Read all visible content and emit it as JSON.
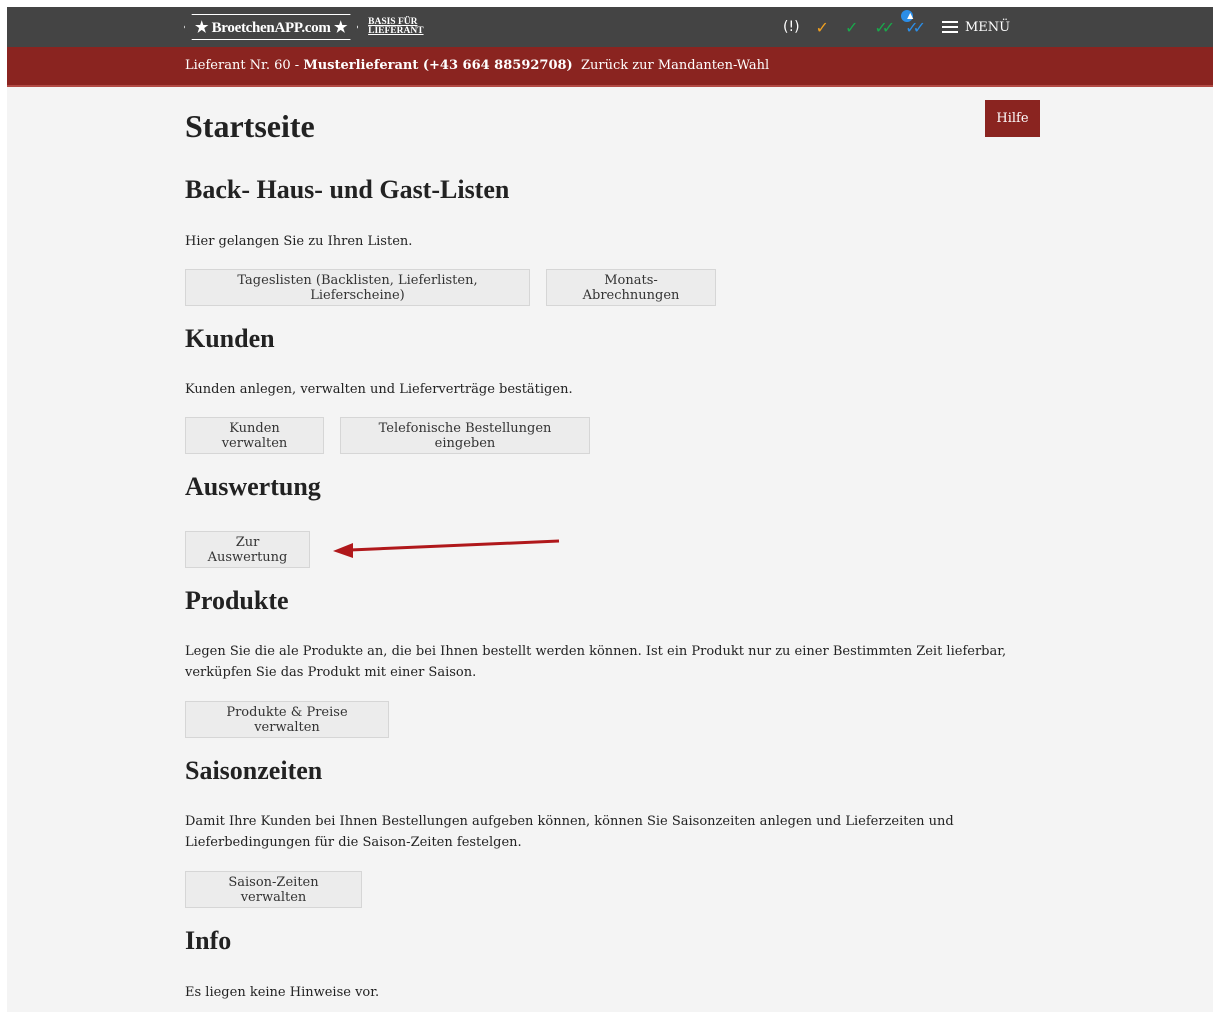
{
  "header": {
    "logo_text": "★ BroetchenAPP.com ★",
    "logo_subtitle_line1": "BASIS FÜR",
    "logo_subtitle_line2": "LIEFERANT",
    "icons": [
      "info-icon",
      "check-orange-icon",
      "check-green-icon",
      "double-check-green-icon",
      "double-check-blue-icon"
    ],
    "menu_label": "MENÜ",
    "colors": {
      "topbar": "#444444",
      "accent": "#8a2420"
    }
  },
  "supplier_bar": {
    "prefix": "Lieferant Nr. 60 - ",
    "name": "Musterlieferant (+43 664 88592708)",
    "back_link": "Zurück zur Mandanten-Wahl"
  },
  "page": {
    "title": "Startseite",
    "help_button": "Hilfe"
  },
  "sections": {
    "listen": {
      "heading": "Back- Haus- und Gast-Listen",
      "text": "Hier gelangen Sie zu Ihren Listen.",
      "buttons": [
        "Tageslisten (Backlisten, Lieferlisten, Lieferscheine)",
        "Monats-Abrechnungen"
      ]
    },
    "kunden": {
      "heading": "Kunden",
      "text": "Kunden anlegen, verwalten und Lieferverträge bestätigen.",
      "buttons": [
        "Kunden verwalten",
        "Telefonische Bestellungen eingeben"
      ]
    },
    "auswertung": {
      "heading": "Auswertung",
      "buttons": [
        "Zur Auswertung"
      ]
    },
    "produkte": {
      "heading": "Produkte",
      "text": "Legen Sie die ale Produkte an, die bei Ihnen bestellt werden können. Ist ein Produkt nur zu einer Bestimmten Zeit lieferbar, verküpfen Sie das Produkt mit einer Saison.",
      "buttons": [
        "Produkte & Preise verwalten"
      ]
    },
    "saison": {
      "heading": "Saisonzeiten",
      "text": "Damit Ihre Kunden bei Ihnen Bestellungen aufgeben können, können Sie Saisonzeiten anlegen und Lieferzeiten und Lieferbedingungen für die Saison-Zeiten festelgen.",
      "buttons": [
        "Saison-Zeiten verwalten"
      ]
    },
    "info": {
      "heading": "Info",
      "text": "Es liegen keine Hinweise vor."
    }
  }
}
